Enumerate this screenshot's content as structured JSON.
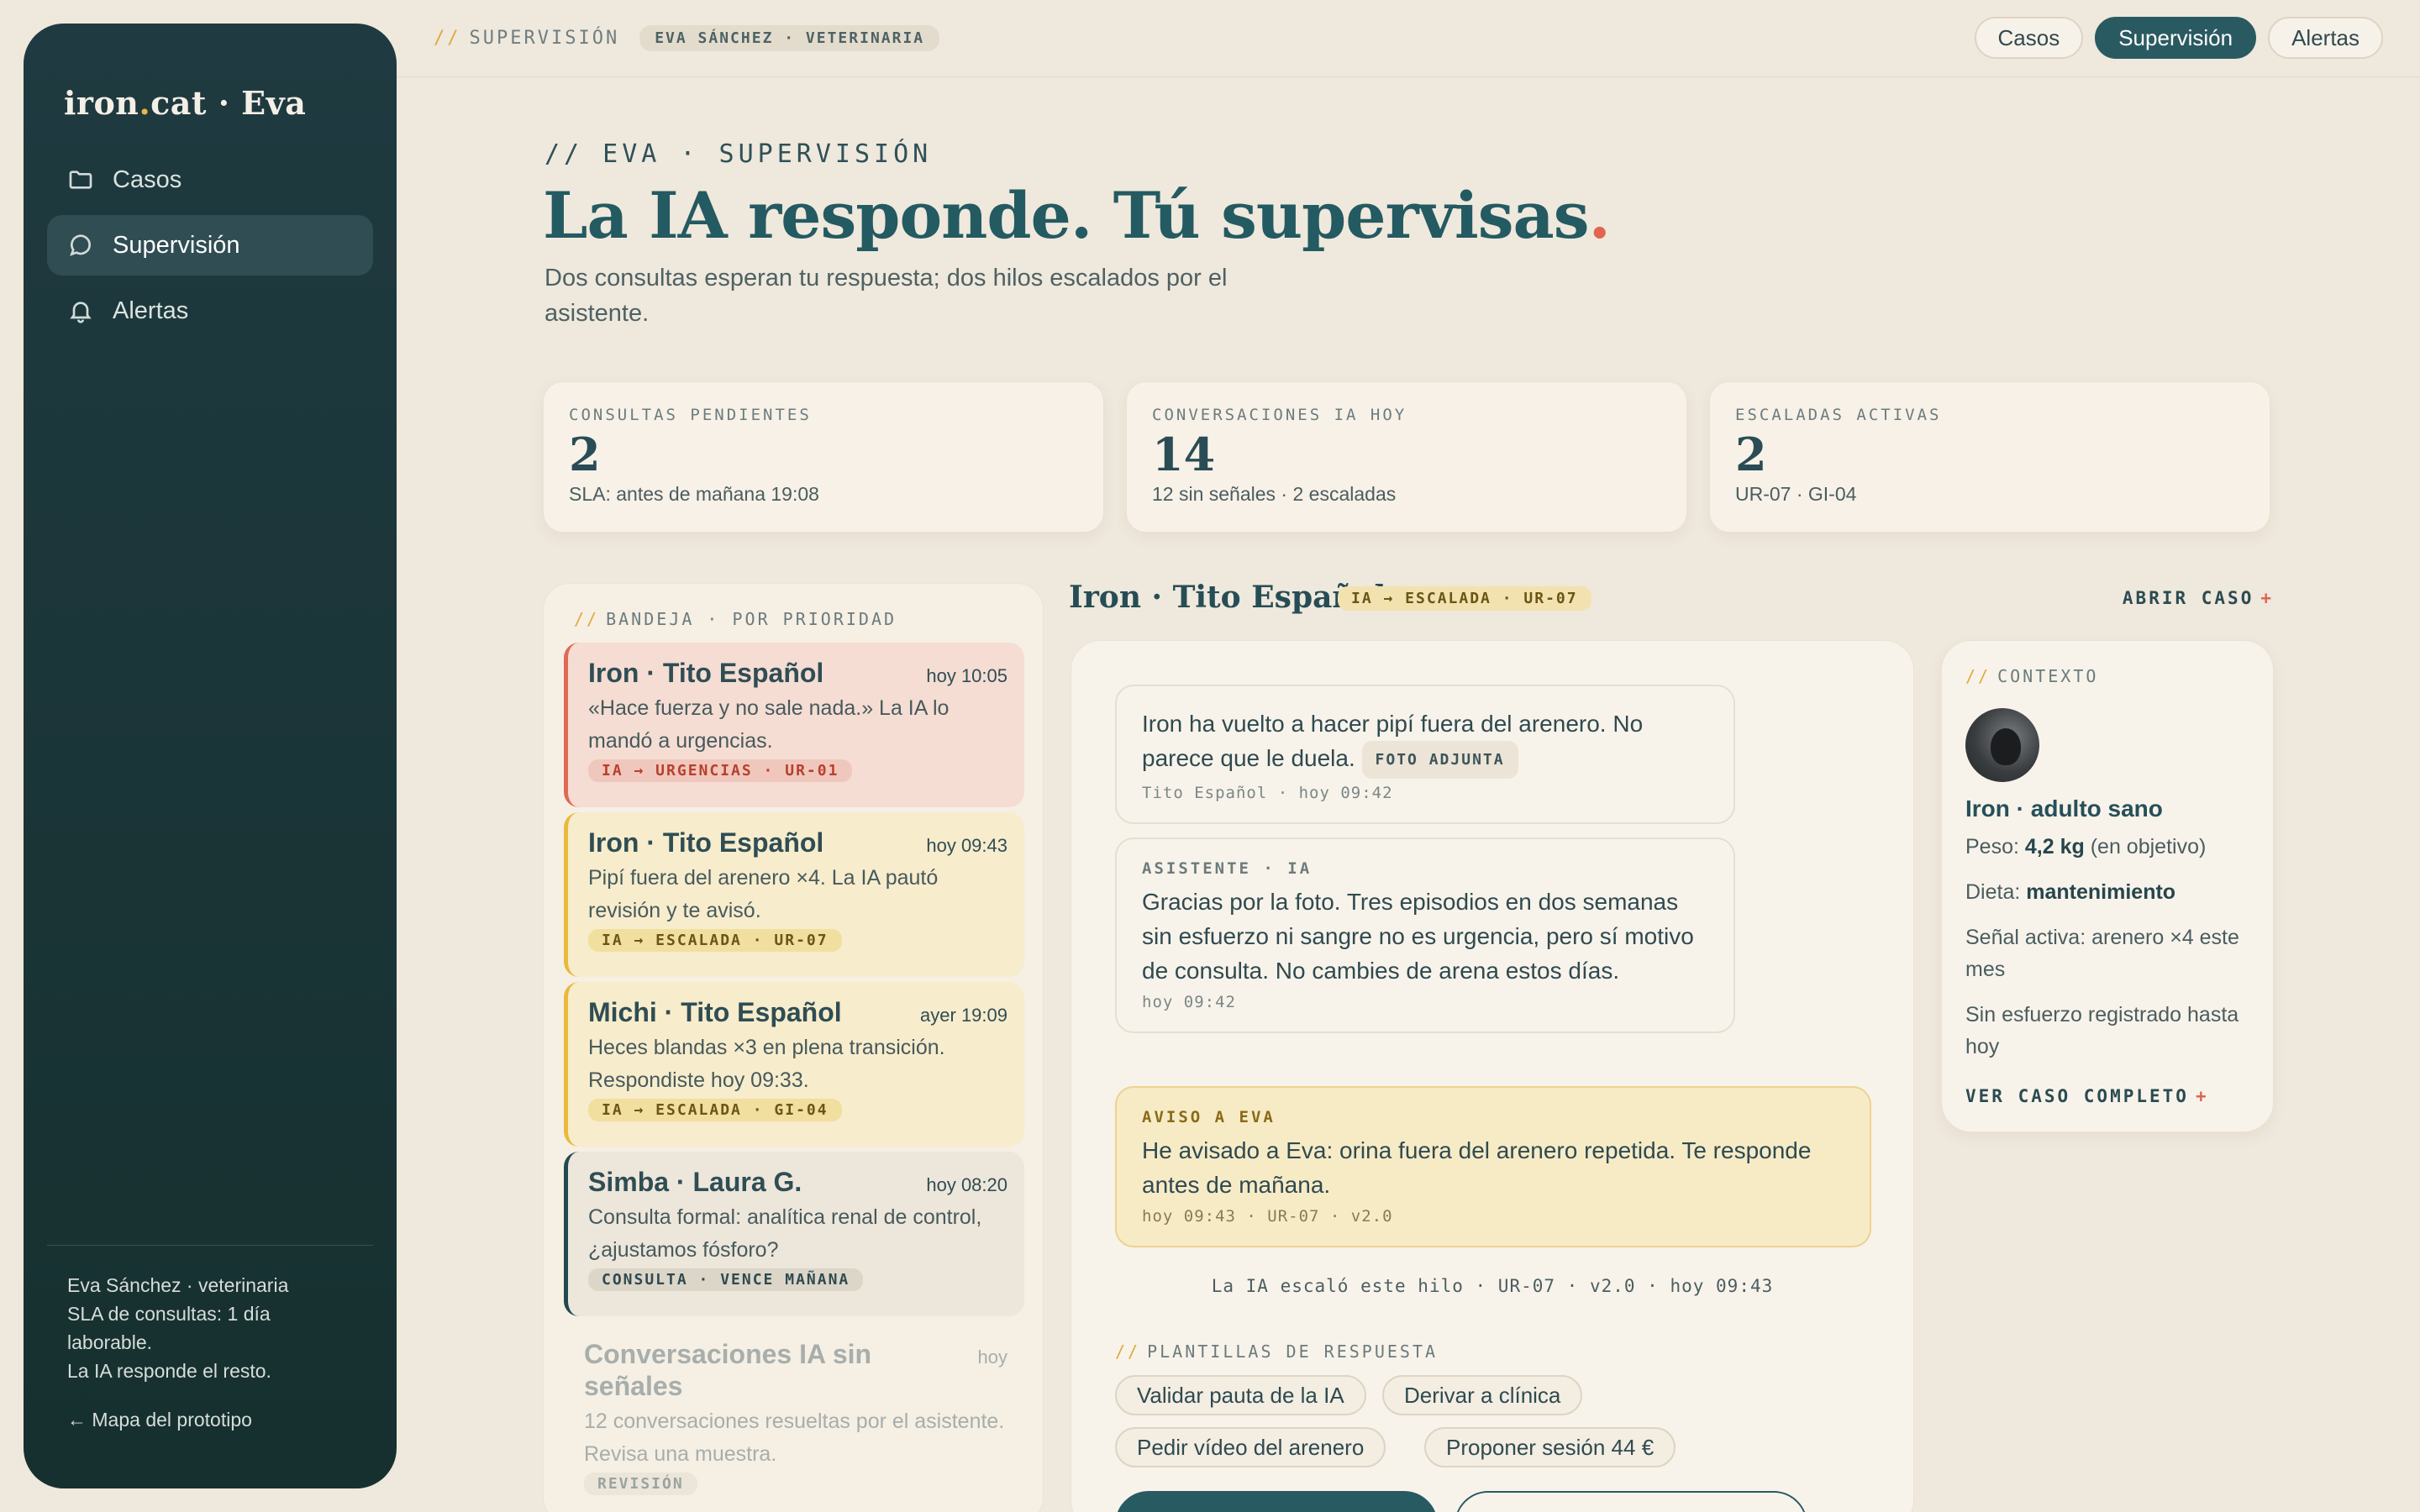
{
  "sidebar": {
    "brand": {
      "a": "iron",
      "dot": ".",
      "b": "cat · Eva"
    },
    "items": [
      {
        "label": "Casos",
        "icon": "folder-icon"
      },
      {
        "label": "Supervisión",
        "icon": "chat-icon"
      },
      {
        "label": "Alertas",
        "icon": "bell-icon"
      }
    ],
    "footer": {
      "line1": "Eva Sánchez · veterinaria",
      "line2": "SLA de consultas: 1 día",
      "line3": "laborable.",
      "line4": "La IA responde el resto.",
      "map_link": "← Mapa del prototipo"
    }
  },
  "topbar": {
    "prefix": "//",
    "crumb": "SUPERVISIÓN",
    "user_badge": "EVA SÁNCHEZ · VETERINARIA",
    "tabs": [
      "Casos",
      "Supervisión",
      "Alertas"
    ],
    "active_tab": "Supervisión"
  },
  "header": {
    "eyebrow": "// EVA · SUPERVISIÓN",
    "title": "La IA responde. Tú supervisas",
    "title_dot": ".",
    "subtitle": "Dos consultas esperan tu respuesta; dos hilos escalados por el asistente."
  },
  "stats": [
    {
      "label": "CONSULTAS PENDIENTES",
      "value": "2",
      "note": "SLA: antes de mañana 19:08"
    },
    {
      "label": "CONVERSACIONES IA HOY",
      "value": "14",
      "note": "12 sin señales · 2 escaladas"
    },
    {
      "label": "ESCALADAS ACTIVAS",
      "value": "2",
      "note": "UR-07 · GI-04"
    }
  ],
  "inbox": {
    "prefix": "//",
    "title": "BANDEJA · POR PRIORIDAD",
    "items": [
      {
        "name": "Iron · Tito Español",
        "time": "hoy 10:05",
        "text": "«Hace fuerza y no sale nada.» La IA lo mandó a urgencias.",
        "tag": "IA → URGENCIAS · UR-01"
      },
      {
        "name": "Iron · Tito Español",
        "time": "hoy 09:43",
        "text": "Pipí fuera del arenero ×4. La IA pautó revisión y te avisó.",
        "tag": "IA → ESCALADA · UR-07"
      },
      {
        "name": "Michi · Tito Español",
        "time": "ayer 19:09",
        "text": "Heces blandas ×3 en plena transición. Respondiste hoy 09:33.",
        "tag": "IA → ESCALADA · GI-04"
      },
      {
        "name": "Simba · Laura G.",
        "time": "hoy 08:20",
        "text": "Consulta formal: analítica renal de control, ¿ajustamos fósforo?",
        "tag": "CONSULTA · VENCE MAÑANA"
      },
      {
        "name": "Conversaciones IA sin señales",
        "time": "hoy",
        "text": "12 conversaciones resueltas por el asistente. Revisa una muestra.",
        "tag": "REVISIÓN"
      }
    ]
  },
  "thread": {
    "title": "Iron · Tito Español",
    "badge": "IA → ESCALADA · UR-07",
    "open_case": "ABRIR CASO",
    "plus": "+",
    "messages": [
      {
        "body": "Iron ha vuelto a hacer pipí fuera del arenero. No parece que le duela.",
        "attachment": "FOTO ADJUNTA",
        "meta": "Tito Español · hoy 09:42"
      },
      {
        "who": "ASISTENTE · IA",
        "body": "Gracias por la foto. Tres episodios en dos semanas sin esfuerzo ni sangre no es urgencia, pero sí motivo de consulta. No cambies de arena estos días.",
        "meta": "hoy 09:42"
      },
      {
        "who": "AVISO A EVA",
        "body": "He avisado a Eva: orina fuera del arenero repetida. Te responde antes de mañana.",
        "meta": "hoy 09:43 · UR-07 · v2.0"
      }
    ],
    "escalation_note": "La IA escaló este hilo · UR-07 · v2.0 · hoy 09:43",
    "templates_prefix": "//",
    "templates_title": "PLANTILLAS DE RESPUESTA",
    "templates": [
      "Validar pauta de la IA",
      "Derivar a clínica",
      "Pedir vídeo del arenero",
      "Proponer sesión 44 €"
    ]
  },
  "context": {
    "prefix": "//",
    "title": "CONTEXTO",
    "name": "Iron · adulto sano",
    "weight_label": "Peso:",
    "weight_value": "4,2 kg",
    "weight_note": "(en objetivo)",
    "diet_label": "Dieta:",
    "diet_value": "mantenimiento",
    "signal": "Señal activa: arenero ×4 este mes",
    "effort": "Sin esfuerzo registrado hasta hoy",
    "link": "VER CASO COMPLETO",
    "plus": "+"
  },
  "colors": {
    "sidebar_bg": "#1f3a40",
    "accent": "#2a5a61",
    "danger": "#de6a55",
    "warning": "#e8b93e",
    "gold": "#e0a93d"
  }
}
